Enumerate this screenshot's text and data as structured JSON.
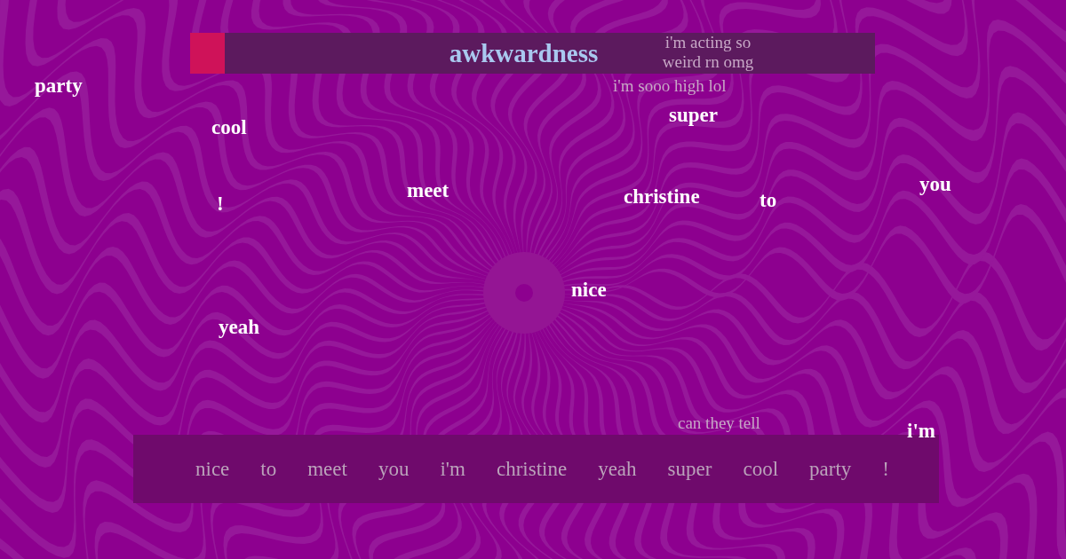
{
  "meter": {
    "label": "awkwardness",
    "level": 0.05
  },
  "thoughts": [
    {
      "text": "i'm acting so weird rn omg"
    },
    {
      "text": "i'm sooo high lol"
    },
    {
      "text": "can they tell"
    }
  ],
  "floating_words": [
    "party",
    "super",
    "cool",
    "!",
    "meet",
    "christine",
    "to",
    "you",
    "nice",
    "yeah",
    "i'm"
  ],
  "sentence": [
    "nice",
    "to",
    "meet",
    "you",
    "i'm",
    "christine",
    "yeah",
    "super",
    "cool",
    "party",
    "!"
  ]
}
